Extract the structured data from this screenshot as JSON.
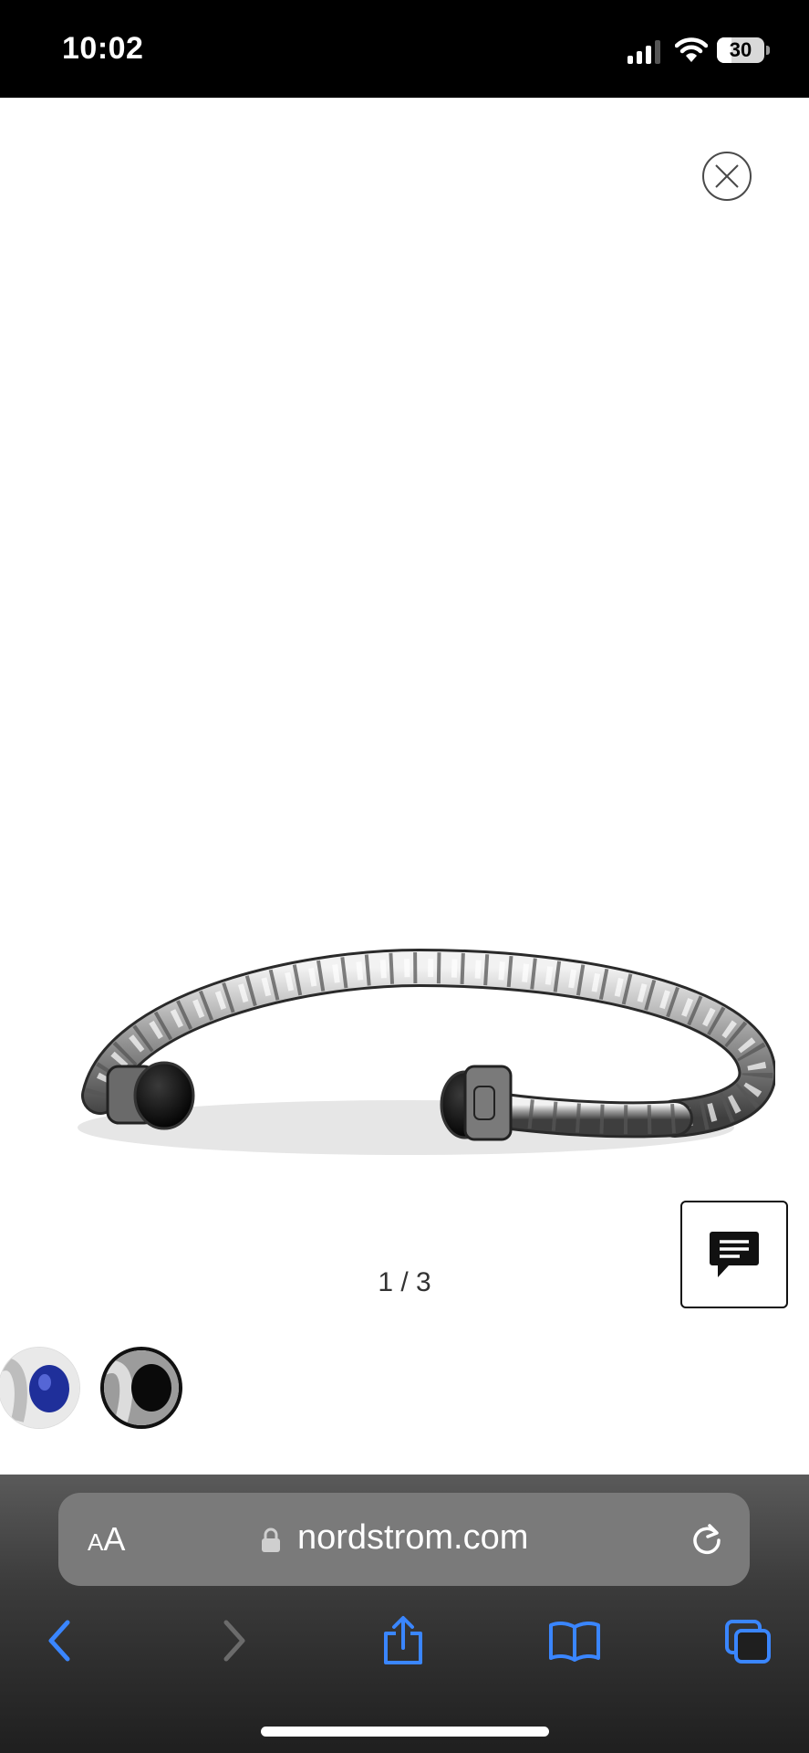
{
  "status_bar": {
    "time": "10:02",
    "battery_level": "30",
    "icons": [
      "signal-icon",
      "wifi-icon",
      "battery-icon"
    ]
  },
  "viewer": {
    "counter": "1 / 3",
    "current_index": 1,
    "total_images": 3,
    "close_icon": "close-icon",
    "chat_icon": "chat-icon",
    "thumbnails": [
      {
        "name": "lapis-variant",
        "stone_color": "#1f2f9a",
        "selected": false
      },
      {
        "name": "black-onyx-variant",
        "stone_color": "#0a0a0a",
        "selected": true
      }
    ]
  },
  "browser": {
    "aa_small": "A",
    "aa_big": "A",
    "url": "nordstrom.com",
    "accent_color": "#3a86ff",
    "toolbar_icons": [
      "back-icon",
      "forward-icon",
      "share-icon",
      "bookmarks-icon",
      "tabs-icon"
    ]
  }
}
